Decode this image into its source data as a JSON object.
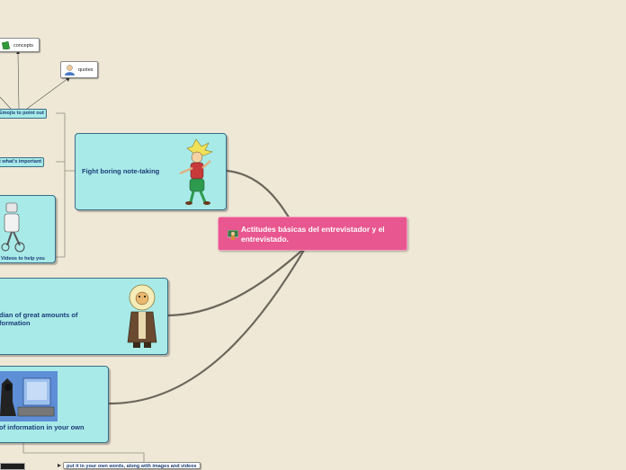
{
  "central": {
    "title": "Actitudes básicas del entrevistador y el entrevistado.",
    "icon": "classroom-teacher-icon"
  },
  "topics": {
    "fight": {
      "label": "Fight boring note-taking",
      "image": "cartoon-warrior-illustration"
    },
    "guardian": {
      "label": "dian of great amounts of formation",
      "image": "cartoon-lion-jedi-illustration"
    },
    "information": {
      "label": "of information in your own",
      "image": "cartoon-dark-knight-at-computer-illustration"
    },
    "videos": {
      "label": "Videos to help you",
      "image": "cartoon-robot-illustration"
    }
  },
  "subtopics": {
    "emojis": "Emojis to point out",
    "important": "t what's important",
    "own_words": "put it in your own words, along with images and videos"
  },
  "leaves": {
    "concepts": {
      "label": "concepts",
      "icon": "green-book-icon"
    },
    "quotes": {
      "label": "quotes",
      "icon": "person-icon"
    }
  },
  "colors": {
    "background": "#efe8d6",
    "central_fill": "#e8578f",
    "topic_fill": "#a8eae8",
    "topic_text": "#1c3d78",
    "connector": "#6b655b"
  }
}
